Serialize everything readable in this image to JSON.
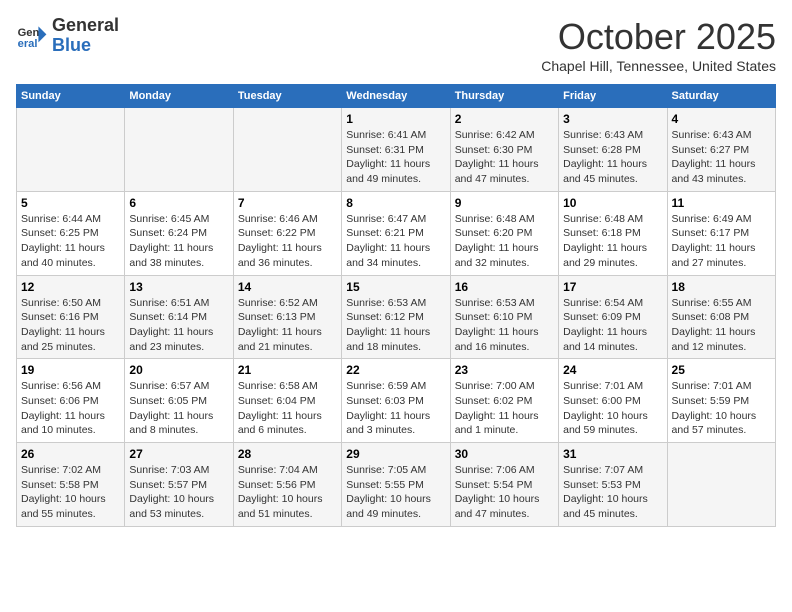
{
  "logo": {
    "general": "General",
    "blue": "Blue"
  },
  "title": "October 2025",
  "location": "Chapel Hill, Tennessee, United States",
  "weekdays": [
    "Sunday",
    "Monday",
    "Tuesday",
    "Wednesday",
    "Thursday",
    "Friday",
    "Saturday"
  ],
  "weeks": [
    [
      {
        "day": "",
        "info": ""
      },
      {
        "day": "",
        "info": ""
      },
      {
        "day": "",
        "info": ""
      },
      {
        "day": "1",
        "info": "Sunrise: 6:41 AM\nSunset: 6:31 PM\nDaylight: 11 hours\nand 49 minutes."
      },
      {
        "day": "2",
        "info": "Sunrise: 6:42 AM\nSunset: 6:30 PM\nDaylight: 11 hours\nand 47 minutes."
      },
      {
        "day": "3",
        "info": "Sunrise: 6:43 AM\nSunset: 6:28 PM\nDaylight: 11 hours\nand 45 minutes."
      },
      {
        "day": "4",
        "info": "Sunrise: 6:43 AM\nSunset: 6:27 PM\nDaylight: 11 hours\nand 43 minutes."
      }
    ],
    [
      {
        "day": "5",
        "info": "Sunrise: 6:44 AM\nSunset: 6:25 PM\nDaylight: 11 hours\nand 40 minutes."
      },
      {
        "day": "6",
        "info": "Sunrise: 6:45 AM\nSunset: 6:24 PM\nDaylight: 11 hours\nand 38 minutes."
      },
      {
        "day": "7",
        "info": "Sunrise: 6:46 AM\nSunset: 6:22 PM\nDaylight: 11 hours\nand 36 minutes."
      },
      {
        "day": "8",
        "info": "Sunrise: 6:47 AM\nSunset: 6:21 PM\nDaylight: 11 hours\nand 34 minutes."
      },
      {
        "day": "9",
        "info": "Sunrise: 6:48 AM\nSunset: 6:20 PM\nDaylight: 11 hours\nand 32 minutes."
      },
      {
        "day": "10",
        "info": "Sunrise: 6:48 AM\nSunset: 6:18 PM\nDaylight: 11 hours\nand 29 minutes."
      },
      {
        "day": "11",
        "info": "Sunrise: 6:49 AM\nSunset: 6:17 PM\nDaylight: 11 hours\nand 27 minutes."
      }
    ],
    [
      {
        "day": "12",
        "info": "Sunrise: 6:50 AM\nSunset: 6:16 PM\nDaylight: 11 hours\nand 25 minutes."
      },
      {
        "day": "13",
        "info": "Sunrise: 6:51 AM\nSunset: 6:14 PM\nDaylight: 11 hours\nand 23 minutes."
      },
      {
        "day": "14",
        "info": "Sunrise: 6:52 AM\nSunset: 6:13 PM\nDaylight: 11 hours\nand 21 minutes."
      },
      {
        "day": "15",
        "info": "Sunrise: 6:53 AM\nSunset: 6:12 PM\nDaylight: 11 hours\nand 18 minutes."
      },
      {
        "day": "16",
        "info": "Sunrise: 6:53 AM\nSunset: 6:10 PM\nDaylight: 11 hours\nand 16 minutes."
      },
      {
        "day": "17",
        "info": "Sunrise: 6:54 AM\nSunset: 6:09 PM\nDaylight: 11 hours\nand 14 minutes."
      },
      {
        "day": "18",
        "info": "Sunrise: 6:55 AM\nSunset: 6:08 PM\nDaylight: 11 hours\nand 12 minutes."
      }
    ],
    [
      {
        "day": "19",
        "info": "Sunrise: 6:56 AM\nSunset: 6:06 PM\nDaylight: 11 hours\nand 10 minutes."
      },
      {
        "day": "20",
        "info": "Sunrise: 6:57 AM\nSunset: 6:05 PM\nDaylight: 11 hours\nand 8 minutes."
      },
      {
        "day": "21",
        "info": "Sunrise: 6:58 AM\nSunset: 6:04 PM\nDaylight: 11 hours\nand 6 minutes."
      },
      {
        "day": "22",
        "info": "Sunrise: 6:59 AM\nSunset: 6:03 PM\nDaylight: 11 hours\nand 3 minutes."
      },
      {
        "day": "23",
        "info": "Sunrise: 7:00 AM\nSunset: 6:02 PM\nDaylight: 11 hours\nand 1 minute."
      },
      {
        "day": "24",
        "info": "Sunrise: 7:01 AM\nSunset: 6:00 PM\nDaylight: 10 hours\nand 59 minutes."
      },
      {
        "day": "25",
        "info": "Sunrise: 7:01 AM\nSunset: 5:59 PM\nDaylight: 10 hours\nand 57 minutes."
      }
    ],
    [
      {
        "day": "26",
        "info": "Sunrise: 7:02 AM\nSunset: 5:58 PM\nDaylight: 10 hours\nand 55 minutes."
      },
      {
        "day": "27",
        "info": "Sunrise: 7:03 AM\nSunset: 5:57 PM\nDaylight: 10 hours\nand 53 minutes."
      },
      {
        "day": "28",
        "info": "Sunrise: 7:04 AM\nSunset: 5:56 PM\nDaylight: 10 hours\nand 51 minutes."
      },
      {
        "day": "29",
        "info": "Sunrise: 7:05 AM\nSunset: 5:55 PM\nDaylight: 10 hours\nand 49 minutes."
      },
      {
        "day": "30",
        "info": "Sunrise: 7:06 AM\nSunset: 5:54 PM\nDaylight: 10 hours\nand 47 minutes."
      },
      {
        "day": "31",
        "info": "Sunrise: 7:07 AM\nSunset: 5:53 PM\nDaylight: 10 hours\nand 45 minutes."
      },
      {
        "day": "",
        "info": ""
      }
    ]
  ]
}
